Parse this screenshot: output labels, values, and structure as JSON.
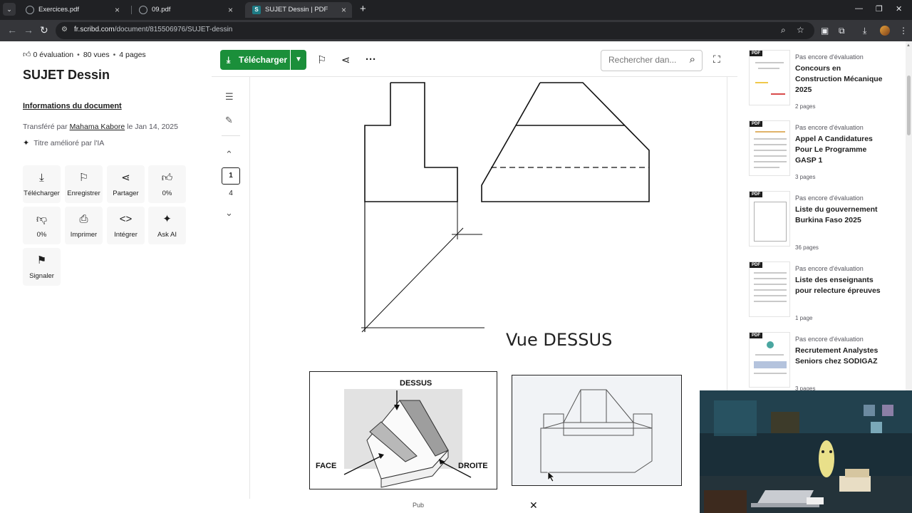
{
  "browser": {
    "tabs": [
      {
        "title": "Exercices.pdf",
        "active": false
      },
      {
        "title": "09.pdf",
        "active": false
      },
      {
        "title": "SUJET Dessin | PDF",
        "active": true
      }
    ],
    "url_host": "fr.scribd.com",
    "url_path": "/document/815506976/SUJET-dessin"
  },
  "doc_info": {
    "rating": "0 évaluation",
    "views": "80 vues",
    "pages": "4 pages",
    "title": "SUJET Dessin",
    "info_link": "Informations du document",
    "uploaded_prefix": "Transféré par",
    "author": "Mahama Kabore",
    "uploaded_suffix": "le Jan 14, 2025",
    "ai_title": "Titre amélioré par l'IA"
  },
  "actions": [
    {
      "label": "Télécharger",
      "icon": "download-icon"
    },
    {
      "label": "Enregistrer",
      "icon": "bookmark-icon"
    },
    {
      "label": "Partager",
      "icon": "share-icon"
    },
    {
      "label": "0%",
      "icon": "thumbs-up-icon"
    },
    {
      "label": "0%",
      "icon": "thumbs-down-icon"
    },
    {
      "label": "Imprimer",
      "icon": "print-icon"
    },
    {
      "label": "Intégrer",
      "icon": "embed-icon"
    },
    {
      "label": "Ask AI",
      "icon": "sparkle-icon"
    },
    {
      "label": "Signaler",
      "icon": "flag-icon"
    }
  ],
  "toolbar": {
    "download_label": "Télécharger",
    "search_placeholder": "Rechercher dan..."
  },
  "pager": {
    "current": "1",
    "total": "4"
  },
  "document": {
    "view_label": "Vue DESSUS",
    "iso_labels": {
      "top": "DESSUS",
      "front": "FACE",
      "right": "DROITE"
    }
  },
  "ad": {
    "label": "Pub",
    "close": "✕"
  },
  "recommendations": [
    {
      "status": "Pas encore d'évaluation",
      "title": "Concours en Construction Mécanique 2025",
      "pages": "2 pages"
    },
    {
      "status": "Pas encore d'évaluation",
      "title": "Appel A Candidatures Pour Le Programme GASP 1",
      "pages": "3 pages"
    },
    {
      "status": "Pas encore d'évaluation",
      "title": "Liste du gouvernement Burkina Faso 2025",
      "pages": "36 pages"
    },
    {
      "status": "Pas encore d'évaluation",
      "title": "Liste des enseignants pour relecture épreuves",
      "pages": "1 page"
    },
    {
      "status": "Pas encore d'évaluation",
      "title": "Recrutement Analystes Seniors chez SODIGAZ",
      "pages": "3 pages"
    }
  ],
  "thumb_badge": "PDF"
}
